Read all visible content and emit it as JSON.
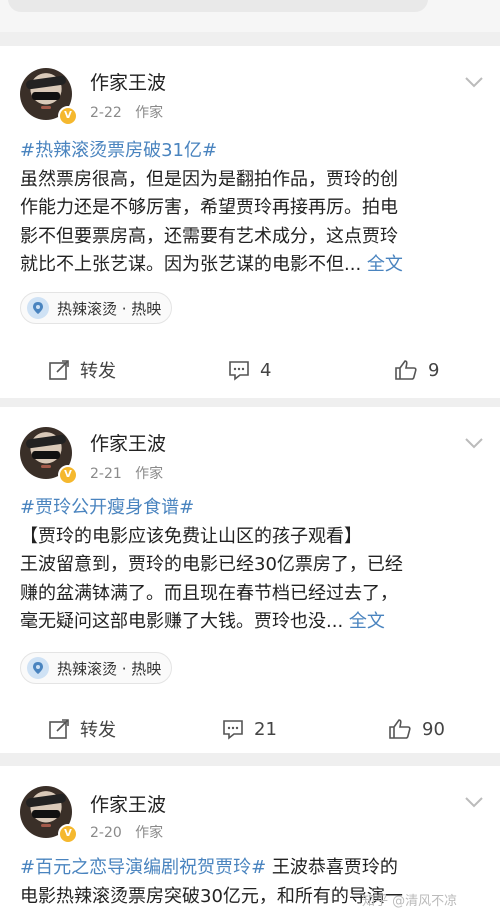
{
  "posts": [
    {
      "author": "作家王波",
      "date": "2-22",
      "role": "作家",
      "hashtag": "#热辣滚烫票房破31亿#",
      "lines": [
        "虽然票房很高，但是因为是翻拍作品，贾玲的创",
        "作能力还是不够厉害，希望贾玲再接再厉。拍电",
        "影不但要票房高，还需要有艺术成分，这点贾玲",
        "就比不上张艺谋。因为张艺谋的电影不但..."
      ],
      "more": "全文",
      "topic_chip": "热辣滚烫 · 热映",
      "repost_label": "转发",
      "comments": "4",
      "likes": "9"
    },
    {
      "author": "作家王波",
      "date": "2-21",
      "role": "作家",
      "hashtag": "#贾玲公开瘦身食谱#",
      "lines": [
        "【贾玲的电影应该免费让山区的孩子观看】",
        "王波留意到，贾玲的电影已经30亿票房了，已经",
        "赚的盆满钵满了。而且现在春节档已经过去了，",
        "毫无疑问这部电影赚了大钱。贾玲也没..."
      ],
      "more": "全文",
      "topic_chip": "热辣滚烫 · 热映",
      "repost_label": "转发",
      "comments": "21",
      "likes": "90"
    },
    {
      "author": "作家王波",
      "date": "2-20",
      "role": "作家",
      "hashtag": "#百元之恋导演编剧祝贺贾玲#",
      "lines": [
        " 王波恭喜贾玲的",
        "电影热辣滚烫票房突破30亿元，和所有的导演一"
      ]
    }
  ],
  "watermark": "知乎 @清风不凉",
  "colors": {
    "link": "#4a84bf",
    "verified": "#f5b82e"
  }
}
